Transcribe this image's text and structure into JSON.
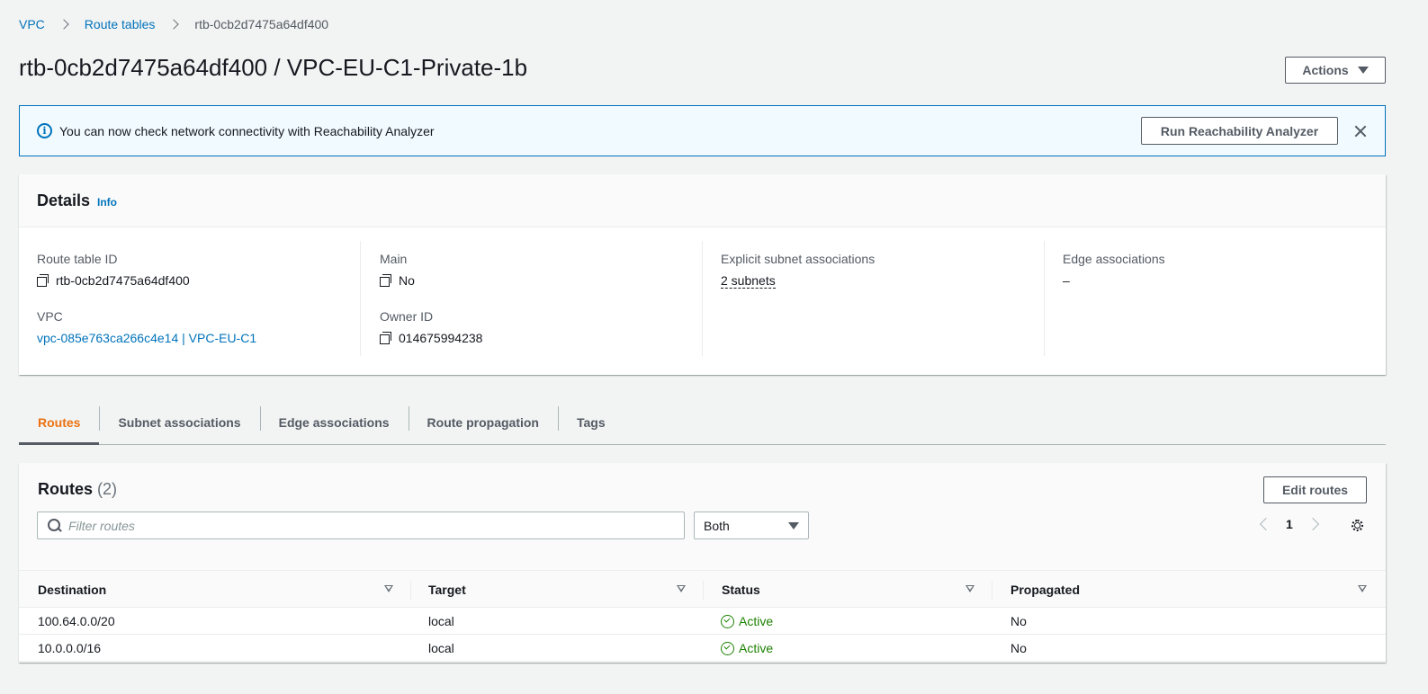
{
  "breadcrumb": {
    "items": [
      "VPC",
      "Route tables"
    ],
    "current": "rtb-0cb2d7475a64df400"
  },
  "page": {
    "title": "rtb-0cb2d7475a64df400 / VPC-EU-C1-Private-1b",
    "actions_label": "Actions"
  },
  "flash": {
    "message": "You can now check network connectivity with Reachability Analyzer",
    "button_label": "Run Reachability Analyzer"
  },
  "details": {
    "title": "Details",
    "info_label": "Info",
    "route_table_id_label": "Route table ID",
    "route_table_id": "rtb-0cb2d7475a64df400",
    "vpc_label": "VPC",
    "vpc": "vpc-085e763ca266c4e14 | VPC-EU-C1",
    "main_label": "Main",
    "main": "No",
    "owner_id_label": "Owner ID",
    "owner_id": "014675994238",
    "explicit_label": "Explicit subnet associations",
    "explicit": "2 subnets",
    "edge_label": "Edge associations",
    "edge": "–"
  },
  "tabs": [
    "Routes",
    "Subnet associations",
    "Edge associations",
    "Route propagation",
    "Tags"
  ],
  "routes": {
    "title": "Routes",
    "count": "(2)",
    "edit_label": "Edit routes",
    "filter_placeholder": "Filter routes",
    "filter_select": "Both",
    "page": "1",
    "columns": [
      "Destination",
      "Target",
      "Status",
      "Propagated"
    ],
    "rows": [
      {
        "destination": "100.64.0.0/20",
        "target": "local",
        "status": "Active",
        "propagated": "No"
      },
      {
        "destination": "10.0.0.0/16",
        "target": "local",
        "status": "Active",
        "propagated": "No"
      }
    ]
  },
  "colors": {
    "link": "#0073bb",
    "active_tab": "#ec7211",
    "status_active": "#1d8102",
    "flash_bg": "#f1faff"
  }
}
